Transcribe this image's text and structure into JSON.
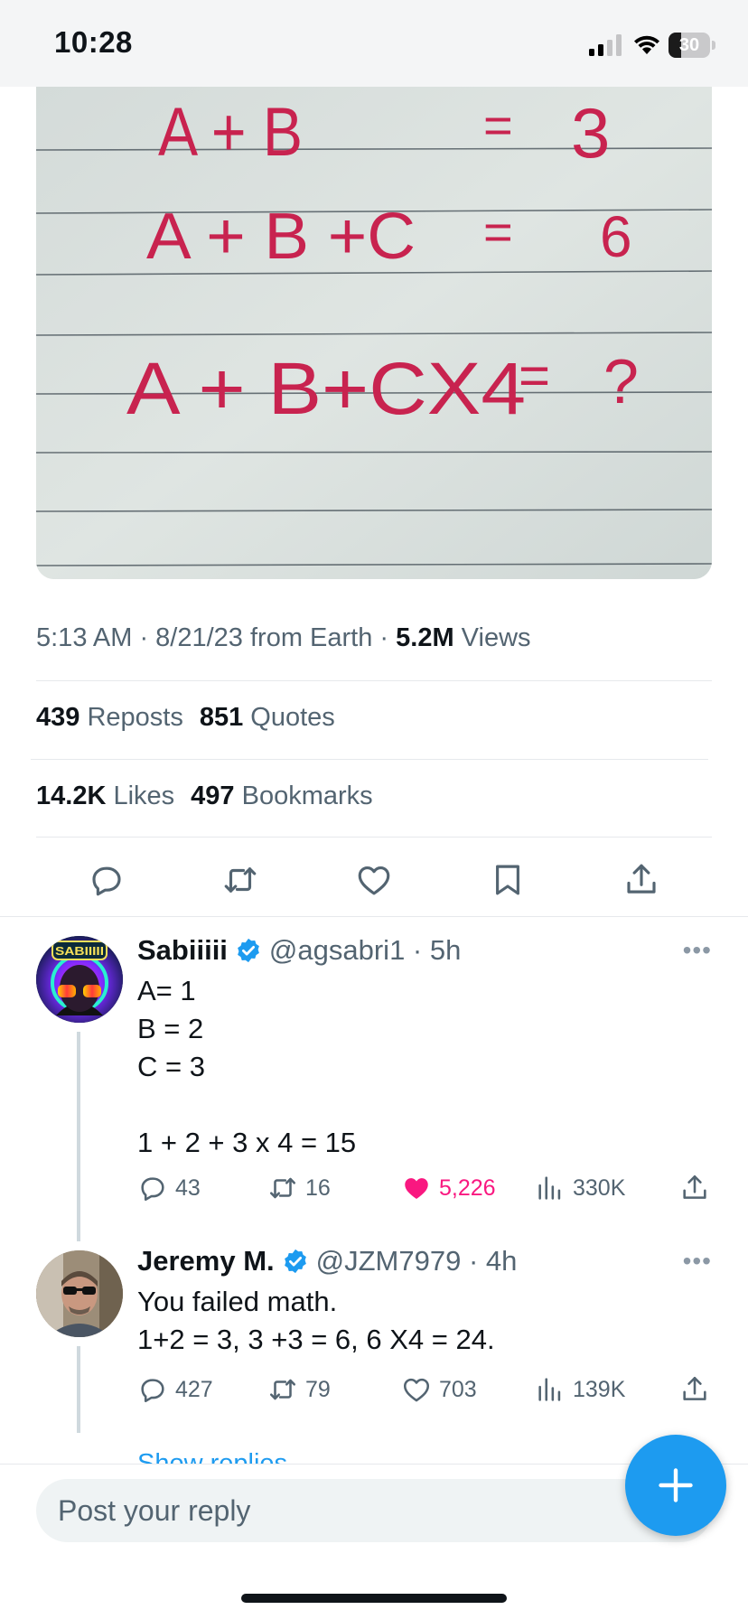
{
  "status_bar": {
    "time": "10:28",
    "battery_percent": "30",
    "battery_level": 0.3,
    "icons": [
      "cellular-signal-icon",
      "wifi-icon",
      "battery-icon"
    ]
  },
  "tweet": {
    "image": {
      "lines": [
        {
          "lhs": "A + B",
          "eq": "=",
          "rhs": "3"
        },
        {
          "lhs": "A + B +C",
          "eq": "=",
          "rhs": "6"
        },
        {
          "lhs": "A + B+CX4",
          "eq": "=",
          "rhs": "?"
        }
      ]
    },
    "meta": {
      "time_text": "5:13 AM · 8/21/23 from Earth · ",
      "views_count": "5.2M",
      "views_label": " Views"
    },
    "stats": {
      "reposts_count": "439",
      "reposts_label": " Reposts",
      "quotes_count": "851",
      "quotes_label": " Quotes",
      "likes_count": "14.2K",
      "likes_label": " Likes",
      "bookmarks_count": "497",
      "bookmarks_label": " Bookmarks"
    },
    "actions": [
      "reply-icon",
      "repost-icon",
      "like-icon",
      "bookmark-icon",
      "share-icon"
    ]
  },
  "replies": [
    {
      "name": "Sabiiiii",
      "handle": "@agsabri1 · 5h",
      "verified": true,
      "avatar_text": "SABIIIII",
      "body": "A= 1\nB = 2\nC = 3\n\n1 + 2 + 3 x 4 = 15",
      "stats": {
        "replies": "43",
        "reposts": "16",
        "likes": "5,226",
        "views": "330K"
      },
      "liked": true
    },
    {
      "name": "Jeremy M.",
      "handle": "@JZM7979 · 4h",
      "verified": true,
      "body": "You failed math.\n1+2 = 3, 3 +3 = 6, 6 X4 = 24.",
      "stats": {
        "replies": "427",
        "reposts": "79",
        "likes": "703",
        "views": "139K"
      },
      "liked": false
    }
  ],
  "show_replies_label": "Show replies",
  "composer": {
    "placeholder": "Post your reply"
  },
  "colors": {
    "accent": "#1d9bf0",
    "like": "#f91880",
    "secondary_text": "#536471",
    "ink": "#c8234f"
  }
}
